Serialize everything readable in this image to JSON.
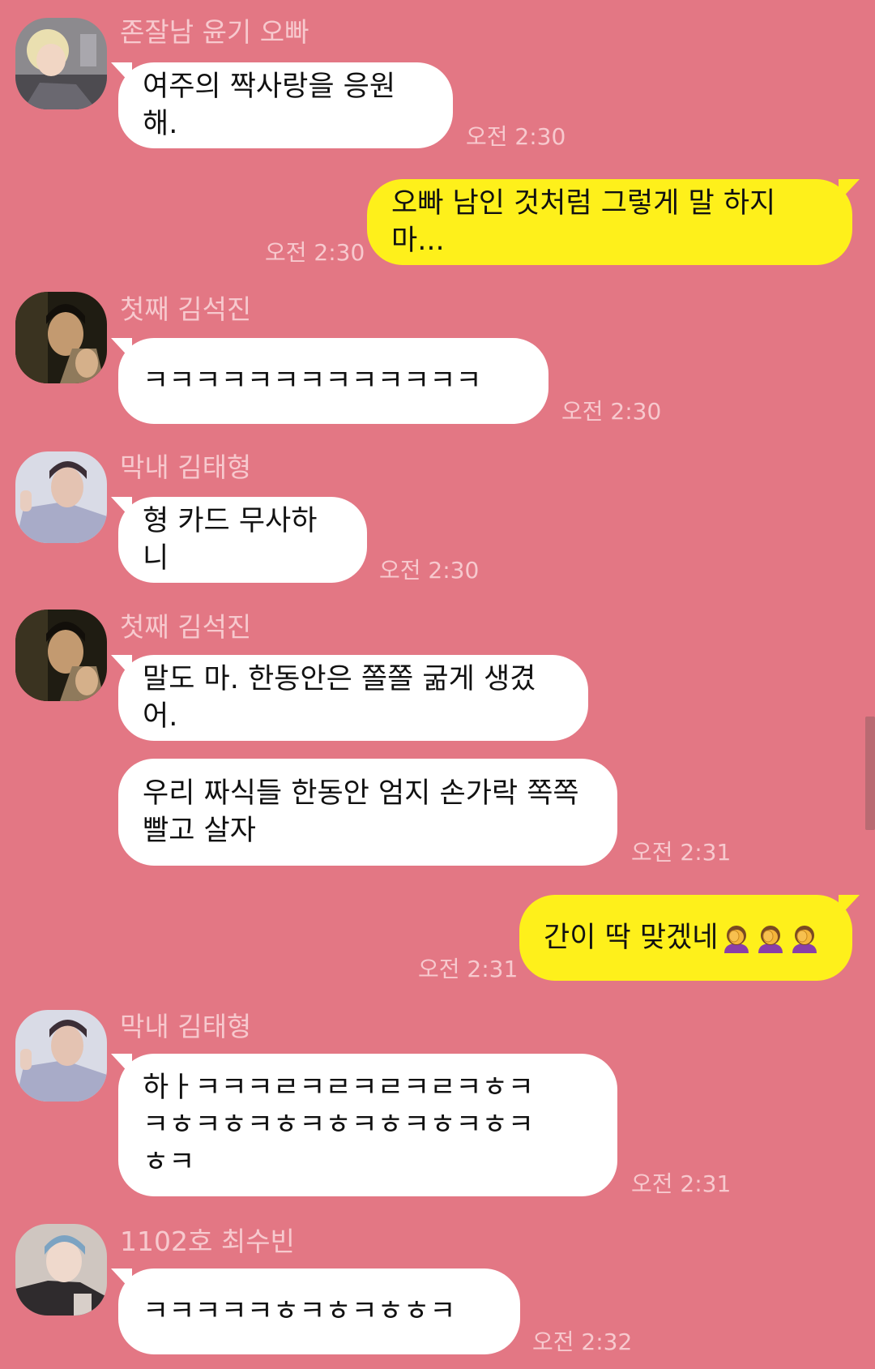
{
  "colors": {
    "background": "#e37784",
    "incoming_bubble": "#ffffff",
    "outgoing_bubble": "#fef01b",
    "meta_text": "#f7c9ce"
  },
  "messages": [
    {
      "sender": "존잘남 윤기 오빠",
      "text": "여주의 짝사랑을 응원해.",
      "time": "오전 2:30",
      "direction": "incoming"
    },
    {
      "text": "오빠 남인 것처럼 그렇게 말 하지 마...",
      "time": "오전 2:30",
      "direction": "outgoing"
    },
    {
      "sender": "첫째 김석진",
      "text": "ㅋㅋㅋㅋㅋㅋㅋㅋㅋㅋㅋㅋㅋ",
      "time": "오전 2:30",
      "direction": "incoming"
    },
    {
      "sender": "막내 김태형",
      "text": "형 카드 무사하니",
      "time": "오전 2:30",
      "direction": "incoming"
    },
    {
      "sender": "첫째 김석진",
      "text": "말도 마. 한동안은 쫄쫄 굶게 생겼어.",
      "direction": "incoming"
    },
    {
      "text": "우리 짜식들 한동안 엄지 손가락 쪽쪽\n빨고 살자",
      "time": "오전 2:31",
      "direction": "incoming"
    },
    {
      "text": "간이 딱 맞겠네",
      "emoji": "face-palm-woman-icon ×3",
      "time": "오전 2:31",
      "direction": "outgoing"
    },
    {
      "sender": "막내 김태형",
      "text": "하ㅏㅋㅋㅋㄹㅋㄹㅋㄹㅋㄹㅋㅎㅋ\nㅋㅎㅋㅎㅋㅎㅋㅎㅋㅎㅋㅎㅋㅎㅋ\nㅎㅋ",
      "time": "오전 2:31",
      "direction": "incoming"
    },
    {
      "sender": "1102호 최수빈",
      "text": "ㅋㅋㅋㅋㅋㅎㅋㅎㅋㅎㅎㅋ",
      "time": "오전 2:32",
      "direction": "incoming"
    }
  ]
}
